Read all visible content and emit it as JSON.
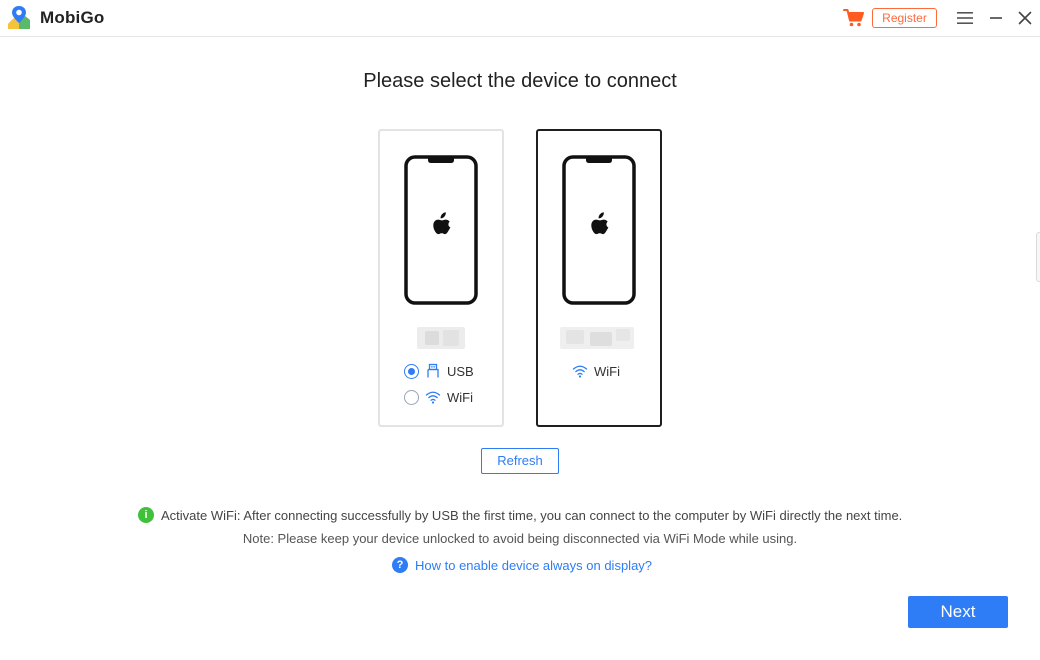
{
  "app": {
    "name": "MobiGo",
    "register_label": "Register",
    "icons": {
      "logo": "map-pin-logo-icon",
      "cart": "cart-icon",
      "menu": "hamburger-menu-icon",
      "minimize": "minimize-icon",
      "close": "close-icon"
    },
    "colors": {
      "accent": "#2e7cf6",
      "register": "#ff6a3d",
      "cart": "#ff5a1f",
      "success": "#3fc23a"
    }
  },
  "main": {
    "title": "Please select the device to connect",
    "devices": [
      {
        "id": "usb-device",
        "options": [
          {
            "label": "USB",
            "icon": "usb-icon",
            "selected": true
          },
          {
            "label": "WiFi",
            "icon": "wifi-icon",
            "selected": false
          }
        ]
      },
      {
        "id": "wifi-device",
        "selected_card": true,
        "connection": {
          "label": "WiFi",
          "icon": "wifi-icon"
        }
      }
    ],
    "refresh_label": "Refresh",
    "info": "Activate WiFi: After connecting successfully by USB the first time, you can connect to the computer by WiFi directly the next time.",
    "note": "Note: Please keep your device unlocked to avoid being disconnected via WiFi Mode while using.",
    "help_link": "How to enable device always on display?",
    "next_label": "Next"
  }
}
